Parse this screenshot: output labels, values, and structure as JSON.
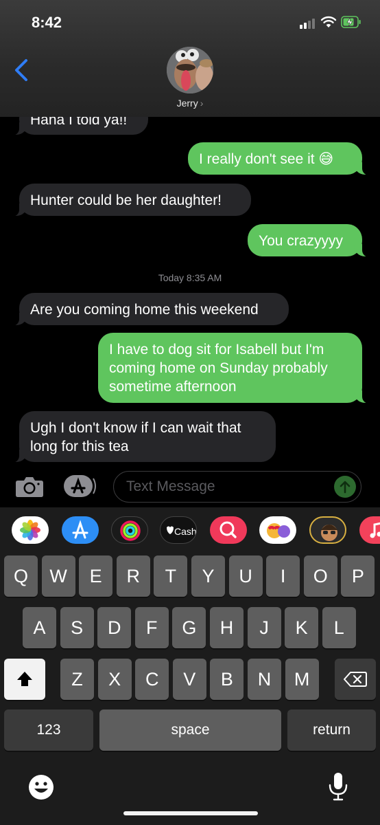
{
  "status_bar": {
    "time": "8:42"
  },
  "header": {
    "contact_name": "Jerry",
    "chevron": "›"
  },
  "messages": {
    "m0": "Haha I told ya!!",
    "m1": "I really don't see it 😅",
    "m2": "Hunter could be her daughter!",
    "m3": "You crazyyyy",
    "timestamp": "Today 8:35 AM",
    "m4": "Are you coming home this weekend",
    "m5_l1": "I have to dog sit for Isabell but I'm",
    "m5_l2": "coming home on Sunday probably",
    "m5_l3": "sometime afternoon",
    "m6_l1": "Ugh I don't know if I can wait that",
    "m6_l2": "long for this tea"
  },
  "compose": {
    "placeholder": "Text Message"
  },
  "app_drawer": {
    "items": [
      "photos-icon",
      "app-store-icon",
      "fitness-icon",
      "apple-cash-icon",
      "search-images-icon",
      "animoji-icon",
      "memoji-icon",
      "music-icon"
    ],
    "cash_label": "Cash"
  },
  "keyboard": {
    "row1": [
      "Q",
      "W",
      "E",
      "R",
      "T",
      "Y",
      "U",
      "I",
      "O",
      "P"
    ],
    "row2": [
      "A",
      "S",
      "D",
      "F",
      "G",
      "H",
      "J",
      "K",
      "L"
    ],
    "row3": [
      "Z",
      "X",
      "C",
      "V",
      "B",
      "N",
      "M"
    ],
    "numbers_label": "123",
    "space_label": "space",
    "return_label": "return"
  },
  "colors": {
    "sent_bubble": "#5fc55e",
    "received_bubble": "#262629",
    "link_blue": "#2f7df6"
  }
}
